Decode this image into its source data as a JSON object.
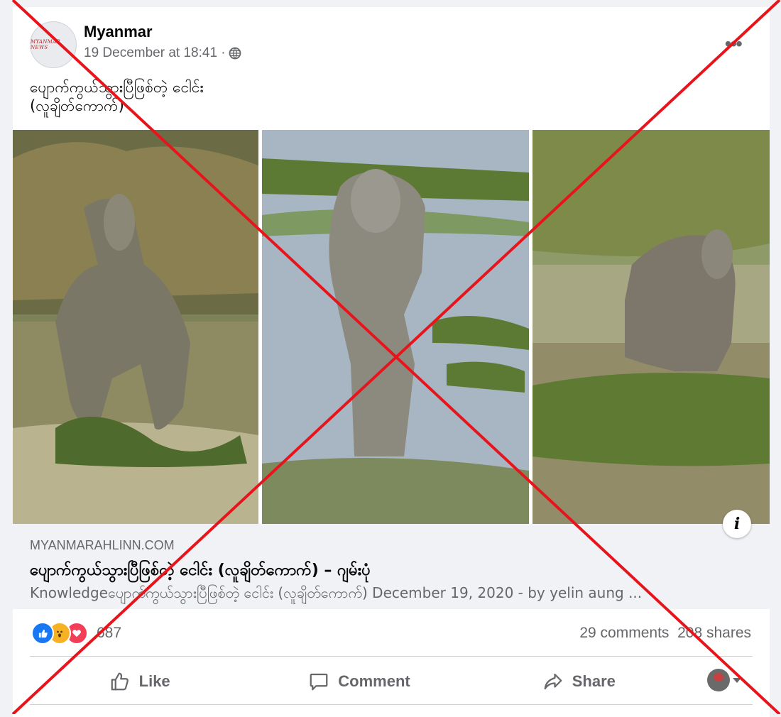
{
  "post": {
    "page_name": "Myanmar",
    "avatar_text": "MYANMAR NEWS",
    "timestamp": "19 December at 18:41 ·",
    "text_line1": "ပျောက်ကွယ်သွားပြီဖြစ်တဲ့ ငေါင်း",
    "text_line2": "(လူချိတ်ကောက်)"
  },
  "link_preview": {
    "domain": "MYANMARAHLINN.COM",
    "title": "ပျောက်ကွယ်သွားပြီဖြစ်တဲ့ ငေါင်း (လူချိတ်ကောက်) – ဂျမ်းပုံ",
    "description": "Knowledgeပျောက်ကွယ်သွားပြီဖြစ်တဲ့ ငေါင်း (လူချိတ်ကောက်) December 19, 2020 - by yelin aung ..."
  },
  "engagement": {
    "reaction_count": "687",
    "comments": "29 comments",
    "shares": "208 shares"
  },
  "actions": {
    "like": "Like",
    "comment": "Comment",
    "share": "Share"
  },
  "icons": [
    "globe-icon",
    "more-icon",
    "info-icon",
    "like-icon",
    "comment-icon",
    "share-icon",
    "chevron-down-icon"
  ],
  "colors": {
    "cross": "#e8141c",
    "like_reaction": "#1877f2",
    "wow_reaction": "#f7b125",
    "love_reaction": "#f33e58"
  }
}
